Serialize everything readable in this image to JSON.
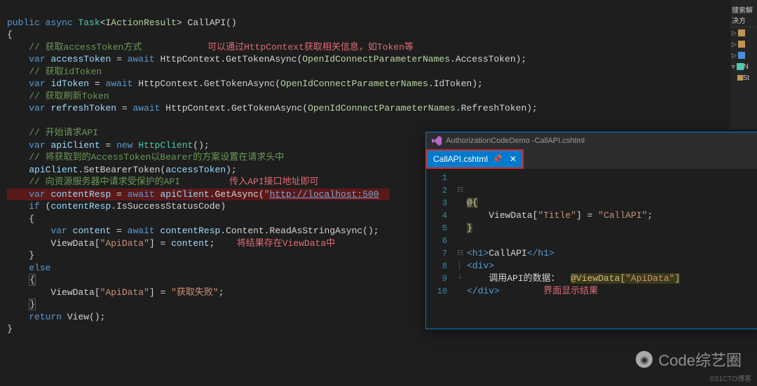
{
  "left_code": {
    "l1": {
      "kw1": "public",
      "kw2": "async",
      "type": "Task",
      "gen": "IActionResult",
      "name": "CallAPI"
    },
    "l2": "{",
    "c1": "// 获取accessToken方式",
    "a1": "可以通过HttpContext获取相关信息，如Token等",
    "l4": {
      "kw": "var",
      "name": "accessToken",
      "aw": "await",
      "obj": "HttpContext",
      "m": "GetTokenAsync",
      "p": "OpenIdConnectParameterNames",
      "prop": "AccessToken"
    },
    "c2": "// 获取idToken",
    "l6": {
      "kw": "var",
      "name": "idToken",
      "aw": "await",
      "obj": "HttpContext",
      "m": "GetTokenAsync",
      "p": "OpenIdConnectParameterNames",
      "prop": "IdToken"
    },
    "c3": "// 获取刷新Token",
    "l8": {
      "kw": "var",
      "name": "refreshToken",
      "aw": "await",
      "obj": "HttpContext",
      "m": "GetTokenAsync",
      "p": "OpenIdConnectParameterNames",
      "prop": "RefreshToken"
    },
    "c4": "// 开始请求API",
    "l11": {
      "kw": "var",
      "name": "apiClient",
      "nw": "new",
      "type": "HttpClient"
    },
    "c5": "// 将获取到的AccessToken以Bearer的方案设置在请求头中",
    "l13": {
      "obj": "apiClient",
      "m": "SetBearerToken",
      "arg": "accessToken"
    },
    "c6": "// 向资源服务器中请求受保护的API",
    "a2": "传入API接口地址即可",
    "l15": {
      "kw": "var",
      "name": "contentResp",
      "aw": "await",
      "obj": "apiClient",
      "m": "GetAsync",
      "url": "http://localhost:500"
    },
    "l16": {
      "kw": "if",
      "obj": "contentResp",
      "prop": "IsSuccessStatusCode"
    },
    "l17": "{",
    "l18": {
      "kw": "var",
      "name": "content",
      "aw": "await",
      "obj": "contentResp",
      "prop": "Content",
      "m": "ReadAsStringAsync"
    },
    "l19": {
      "obj": "ViewData",
      "key": "\"ApiData\"",
      "val": "content"
    },
    "a3": "将结果存在ViewData中",
    "l20": "}",
    "l21": "else",
    "l22": "{",
    "l23": {
      "obj": "ViewData",
      "key": "\"ApiData\"",
      "val": "\"获取失败\""
    },
    "l24": "}",
    "l25": {
      "kw": "return",
      "m": "View"
    }
  },
  "popup": {
    "title_prefix": "AuthorizationCodeDemo - ",
    "title_file": "CallAPI.cshtml",
    "tab": "CallAPI.cshtml",
    "lines": {
      "l2": "@{",
      "l3_a": "ViewData[",
      "l3_b": "\"Title\"",
      "l3_c": "] = ",
      "l3_d": "\"CallAPI\"",
      "l3_e": ";",
      "l4": "}",
      "l6_open": "<h1>",
      "l6_text": "CallAPI",
      "l6_close": "</h1>",
      "l7": "<div>",
      "l8_text": "调用API的数据：",
      "l8_razor": "@ViewData[",
      "l8_key": "\"ApiData\"",
      "l8_end": "]",
      "l9": "</div>",
      "anno": "界面显示结果"
    }
  },
  "solution": {
    "header": "搜索解决方",
    "items": [
      "",
      "",
      "N",
      "St"
    ]
  },
  "watermark": "Code综艺圈",
  "credit": "©51CTO博客"
}
